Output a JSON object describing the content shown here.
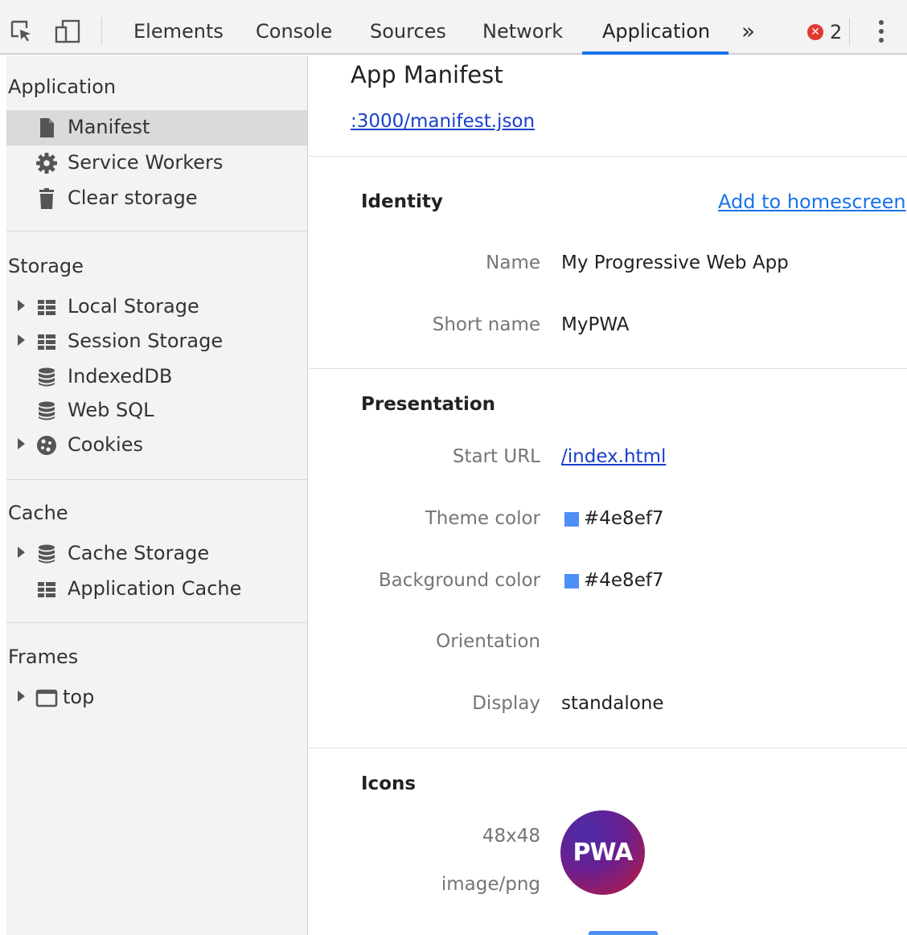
{
  "toolbar": {
    "tabs": [
      "Elements",
      "Console",
      "Sources",
      "Network",
      "Application"
    ],
    "active_tab": "Application",
    "more_tabs": "»",
    "error_count": "2",
    "error_glyph": "✕"
  },
  "sidebar": {
    "application": {
      "title": "Application",
      "items": [
        {
          "label": "Manifest",
          "icon": "document-icon"
        },
        {
          "label": "Service Workers",
          "icon": "gear-icon"
        },
        {
          "label": "Clear storage",
          "icon": "trash-icon"
        }
      ]
    },
    "storage": {
      "title": "Storage",
      "items": [
        {
          "label": "Local Storage",
          "icon": "grid-icon"
        },
        {
          "label": "Session Storage",
          "icon": "grid-icon"
        },
        {
          "label": "IndexedDB",
          "icon": "database-icon"
        },
        {
          "label": "Web SQL",
          "icon": "database-icon"
        },
        {
          "label": "Cookies",
          "icon": "cookie-icon"
        }
      ]
    },
    "cache": {
      "title": "Cache",
      "items": [
        {
          "label": "Cache Storage",
          "icon": "database-icon"
        },
        {
          "label": "Application Cache",
          "icon": "grid-icon"
        }
      ]
    },
    "frames": {
      "title": "Frames",
      "items": [
        {
          "label": "top",
          "icon": "frame-icon"
        }
      ]
    }
  },
  "main": {
    "title": "App Manifest",
    "manifest_link": ":3000/manifest.json",
    "identity": {
      "heading": "Identity",
      "add_to_homescreen": "Add to homescreen",
      "name_label": "Name",
      "name_value": "My Progressive Web App",
      "short_name_label": "Short name",
      "short_name_value": "MyPWA"
    },
    "presentation": {
      "heading": "Presentation",
      "start_url_label": "Start URL",
      "start_url_value": "/index.html",
      "theme_color_label": "Theme color",
      "theme_color_value": "#4e8ef7",
      "background_color_label": "Background color",
      "background_color_value": "#4e8ef7",
      "orientation_label": "Orientation",
      "orientation_value": "",
      "display_label": "Display",
      "display_value": "standalone"
    },
    "icons": {
      "heading": "Icons",
      "size": "48x48",
      "type": "image/png",
      "icon_text": "PWA"
    }
  },
  "colors": {
    "accent": "#1a73e8",
    "link": "#1a3fcc",
    "error": "#e2372f",
    "swatch": "#4e8ef7"
  }
}
